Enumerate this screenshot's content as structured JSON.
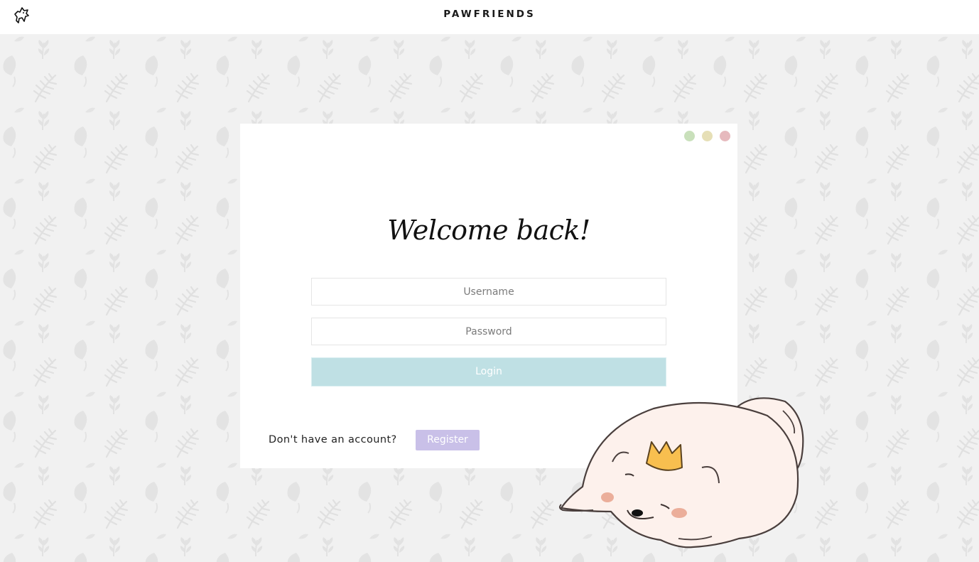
{
  "header": {
    "brand": "PAWFRIENDS",
    "logo_icon": "dog-logo-icon"
  },
  "login": {
    "heading": "Welcome back!",
    "username_placeholder": "Username",
    "password_placeholder": "Password",
    "login_label": "Login",
    "no_account_text": "Don't have an account?",
    "register_label": "Register"
  },
  "window_dots": [
    "#c9e0bb",
    "#e6dfb6",
    "#e6b9bd"
  ],
  "colors": {
    "login_button": "#bfe0e4",
    "register_button": "#c9c0e8",
    "background": "#f1f1f1"
  },
  "illustration": "sleeping-dog-with-crown-illustration"
}
